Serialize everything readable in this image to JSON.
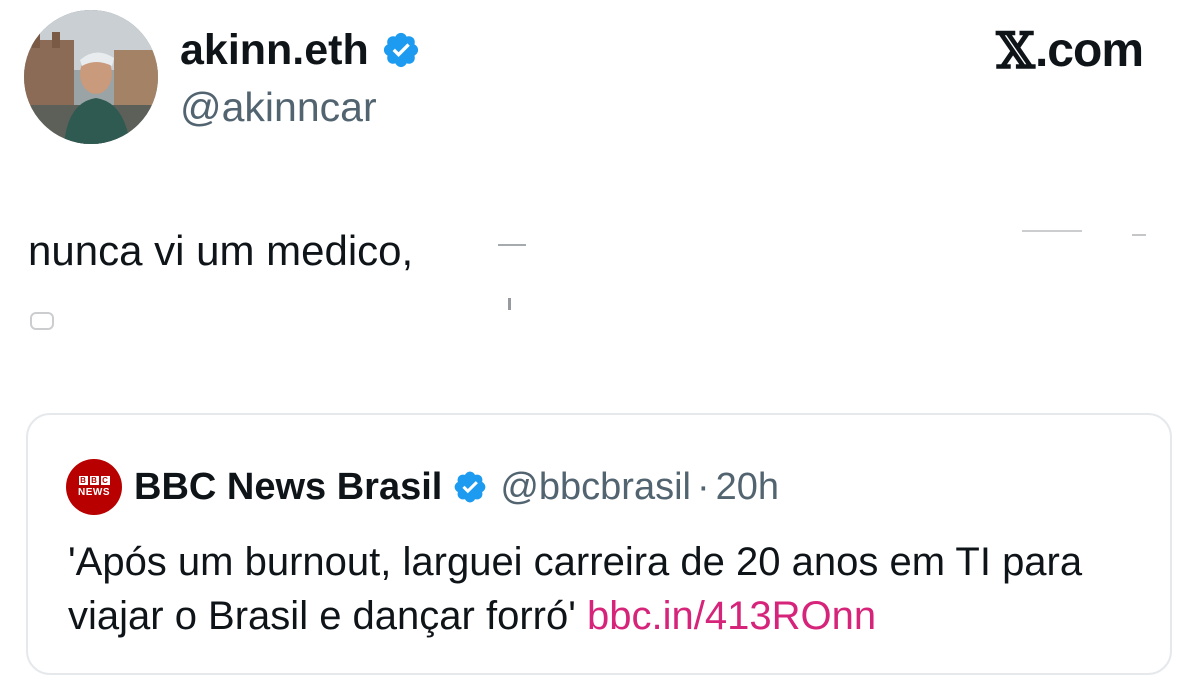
{
  "author": {
    "display_name": "akinn.eth",
    "handle": "@akinncar",
    "verified": true
  },
  "brand": {
    "x_letter": "𝕏",
    "domain": ".com"
  },
  "tweet": {
    "text": "nunca vi um medico,"
  },
  "quoted_tweet": {
    "author_name": "BBC News Brasil",
    "handle": "@bbcbrasil",
    "separator": "·",
    "time": "20h",
    "logo": {
      "letters": [
        "B",
        "B",
        "C"
      ],
      "word": "NEWS"
    },
    "text": "'Após um burnout, larguei carreira de 20 anos em TI para viajar o Brasil e dançar forró'",
    "link": "bbc.in/413ROnn"
  },
  "colors": {
    "verified_blue": "#1d9bf0",
    "link_pink": "#d6247a",
    "bbc_red": "#b80000",
    "secondary_text": "#536471"
  }
}
